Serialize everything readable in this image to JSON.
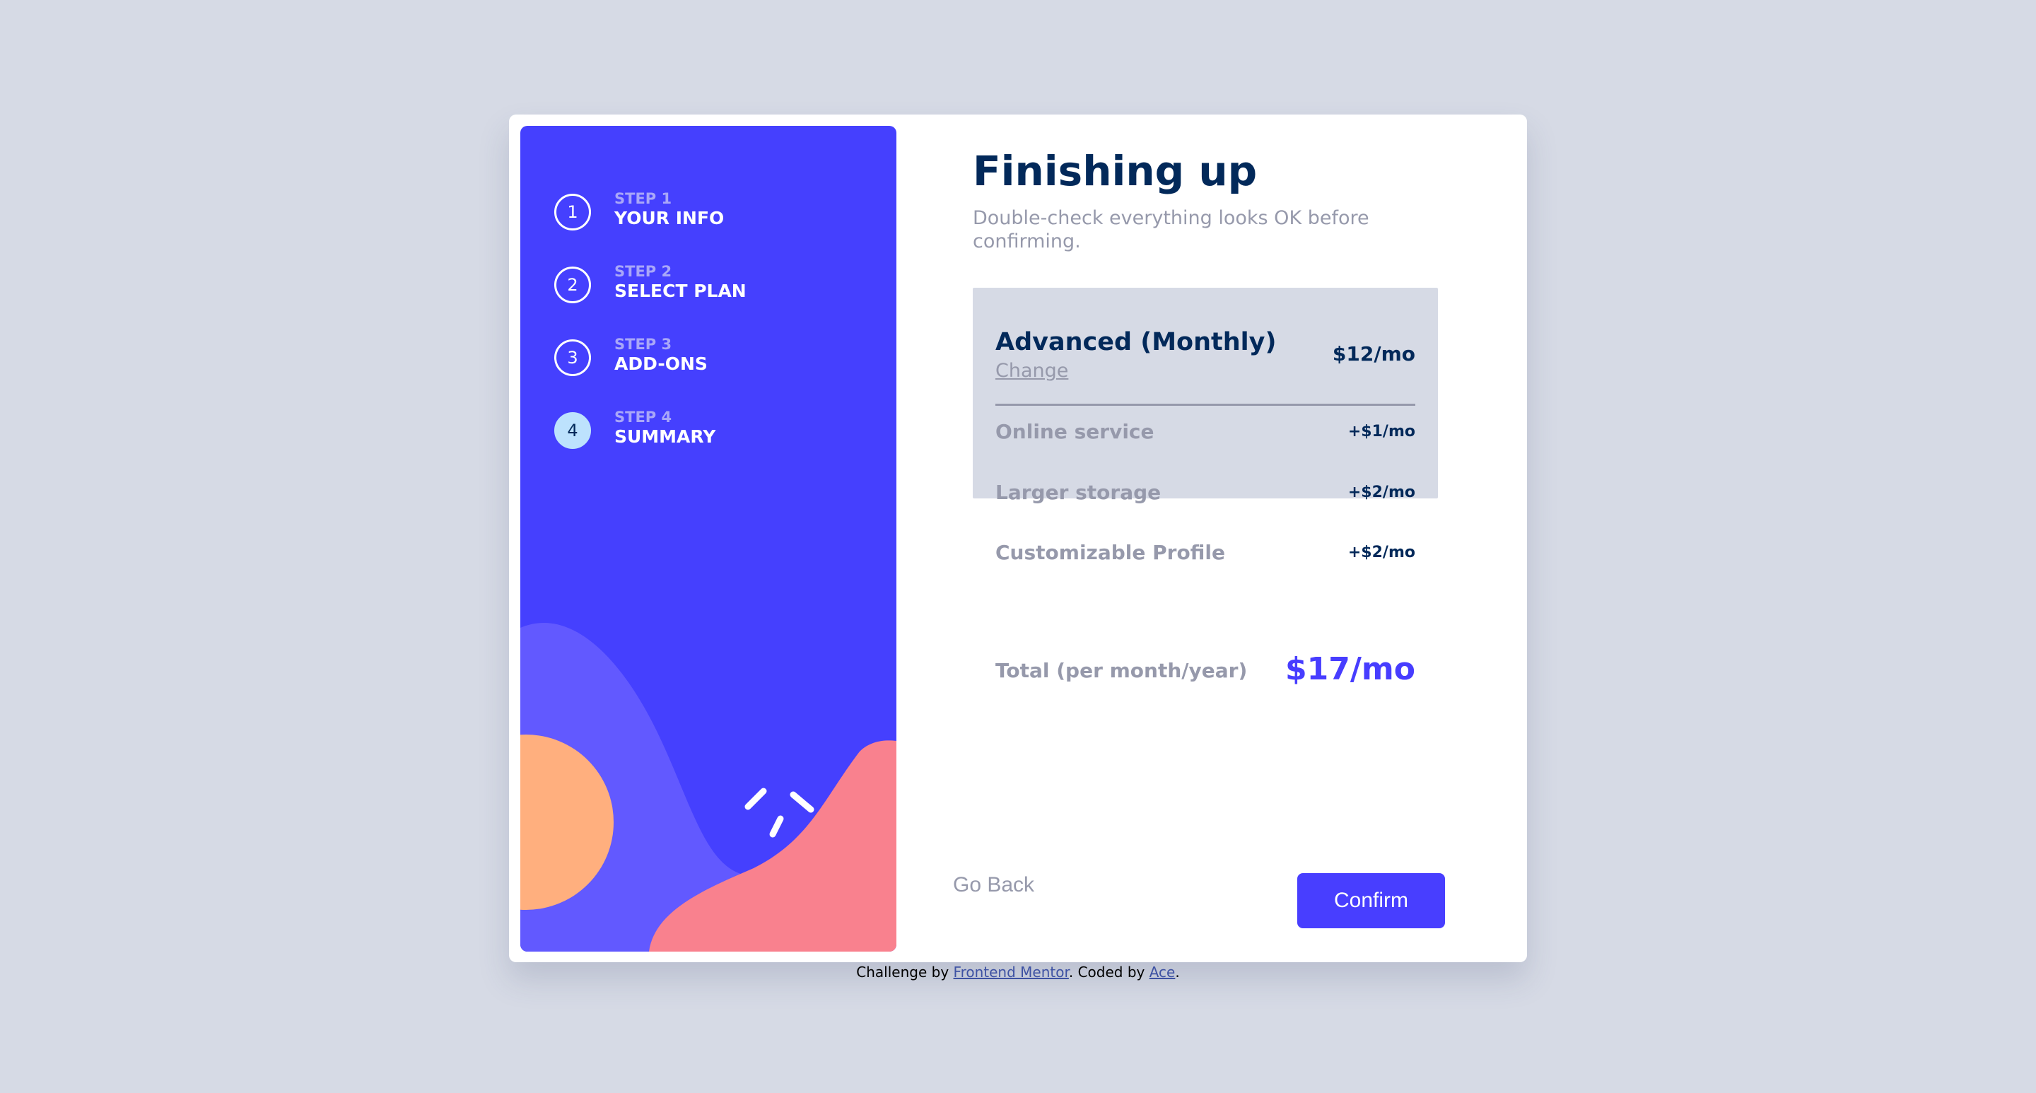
{
  "sidebar": {
    "steps": [
      {
        "number": "1",
        "label": "STEP 1",
        "title": "YOUR INFO",
        "active": false
      },
      {
        "number": "2",
        "label": "STEP 2",
        "title": "SELECT PLAN",
        "active": false
      },
      {
        "number": "3",
        "label": "STEP 3",
        "title": "ADD-ONS",
        "active": false
      },
      {
        "number": "4",
        "label": "STEP 4",
        "title": "SUMMARY",
        "active": true
      }
    ]
  },
  "main": {
    "title": "Finishing up",
    "subtitle": "Double-check everything looks OK before confirming."
  },
  "summary": {
    "plan_name": "Advanced (Monthly)",
    "change_label": "Change",
    "plan_price": "$12/mo",
    "addons": [
      {
        "name": "Online service",
        "price": "+$1/mo"
      },
      {
        "name": "Larger storage",
        "price": "+$2/mo"
      },
      {
        "name": "Customizable Profile",
        "price": "+$2/mo"
      }
    ],
    "total_label": "Total (per month/year)",
    "total_price": "$17/mo"
  },
  "actions": {
    "back_label": "Go Back",
    "confirm_label": "Confirm"
  },
  "footer": {
    "prefix": "Challenge by ",
    "link1": "Frontend Mentor",
    "middle": ". Coded by ",
    "link2": "Ace",
    "suffix": "."
  },
  "colors": {
    "page_background": "#d6dae5",
    "sidebar": "#4540fe",
    "marine_blue": "#02295a",
    "cool_gray": "#9699ab",
    "purplish_blue": "#473dff",
    "light_blue": "#bde2fd",
    "decor_orange": "#ffaf7e",
    "decor_pink": "#f9818e",
    "decor_violet": "#6259ff"
  },
  "icons": {
    "sidebar_decoration": "sidebar-wave-decoration"
  }
}
